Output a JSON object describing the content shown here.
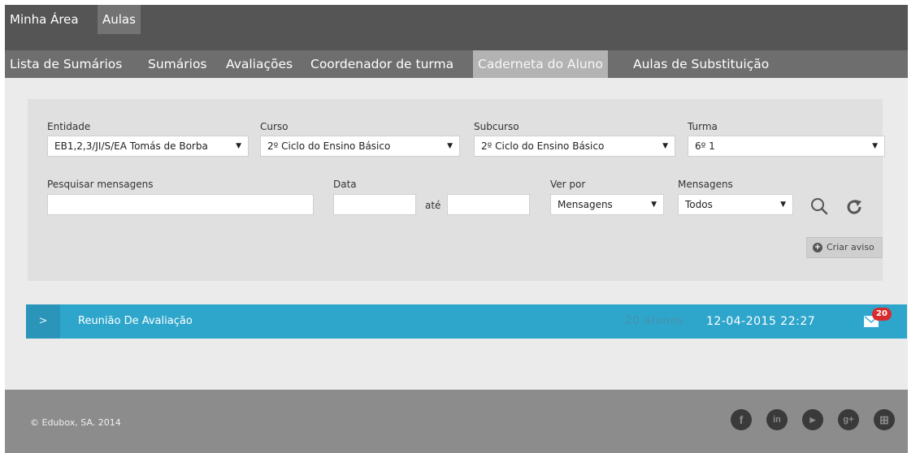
{
  "topnav": {
    "tabs": [
      {
        "label": "Minha Área",
        "active": false
      },
      {
        "label": "Aulas",
        "active": true
      }
    ]
  },
  "subnav": {
    "items": [
      {
        "label": "Lista de Sumários",
        "active": false
      },
      {
        "label": "Sumários",
        "active": false
      },
      {
        "label": "Avaliações",
        "active": false
      },
      {
        "label": "Coordenador de turma",
        "active": false
      },
      {
        "label": "Caderneta do Aluno",
        "active": true
      },
      {
        "label": "Aulas de Substituição",
        "active": false
      }
    ]
  },
  "filters": {
    "entidade": {
      "label": "Entidade",
      "value": "EB1,2,3/JI/S/EA Tomás de Borba"
    },
    "curso": {
      "label": "Curso",
      "value": "2º Ciclo do Ensino Básico"
    },
    "subcurso": {
      "label": "Subcurso",
      "value": "2º Ciclo do Ensino Básico"
    },
    "turma": {
      "label": "Turma",
      "value": "6º 1"
    },
    "pesquisar": {
      "label": "Pesquisar mensagens",
      "value": ""
    },
    "data": {
      "label": "Data",
      "from": "",
      "to": "",
      "between_label": "até"
    },
    "ver_por": {
      "label": "Ver por",
      "value": "Mensagens"
    },
    "mensagens": {
      "label": "Mensagens",
      "value": "Todos"
    }
  },
  "actions": {
    "search_icon": "search-icon",
    "refresh_icon": "refresh-icon",
    "criar_aviso_label": "Criar aviso"
  },
  "message_row": {
    "title": "Reunião De Avaliação",
    "students": "20 alunos",
    "datetime": "12-04-2015 22:27",
    "unread_count": "20"
  },
  "footer": {
    "copyright": "© Edubox, SA. 2014",
    "social": [
      "facebook-icon",
      "linkedin-icon",
      "youtube-icon",
      "google-plus-icon",
      "windows-icon"
    ]
  },
  "colors": {
    "topbar": "#555555",
    "subnav": "#6e6e6e",
    "active_subnav": "#b3b3b3",
    "accent": "#2ea6cc",
    "badge": "#d92b2b",
    "footer": "#8c8c8c"
  }
}
